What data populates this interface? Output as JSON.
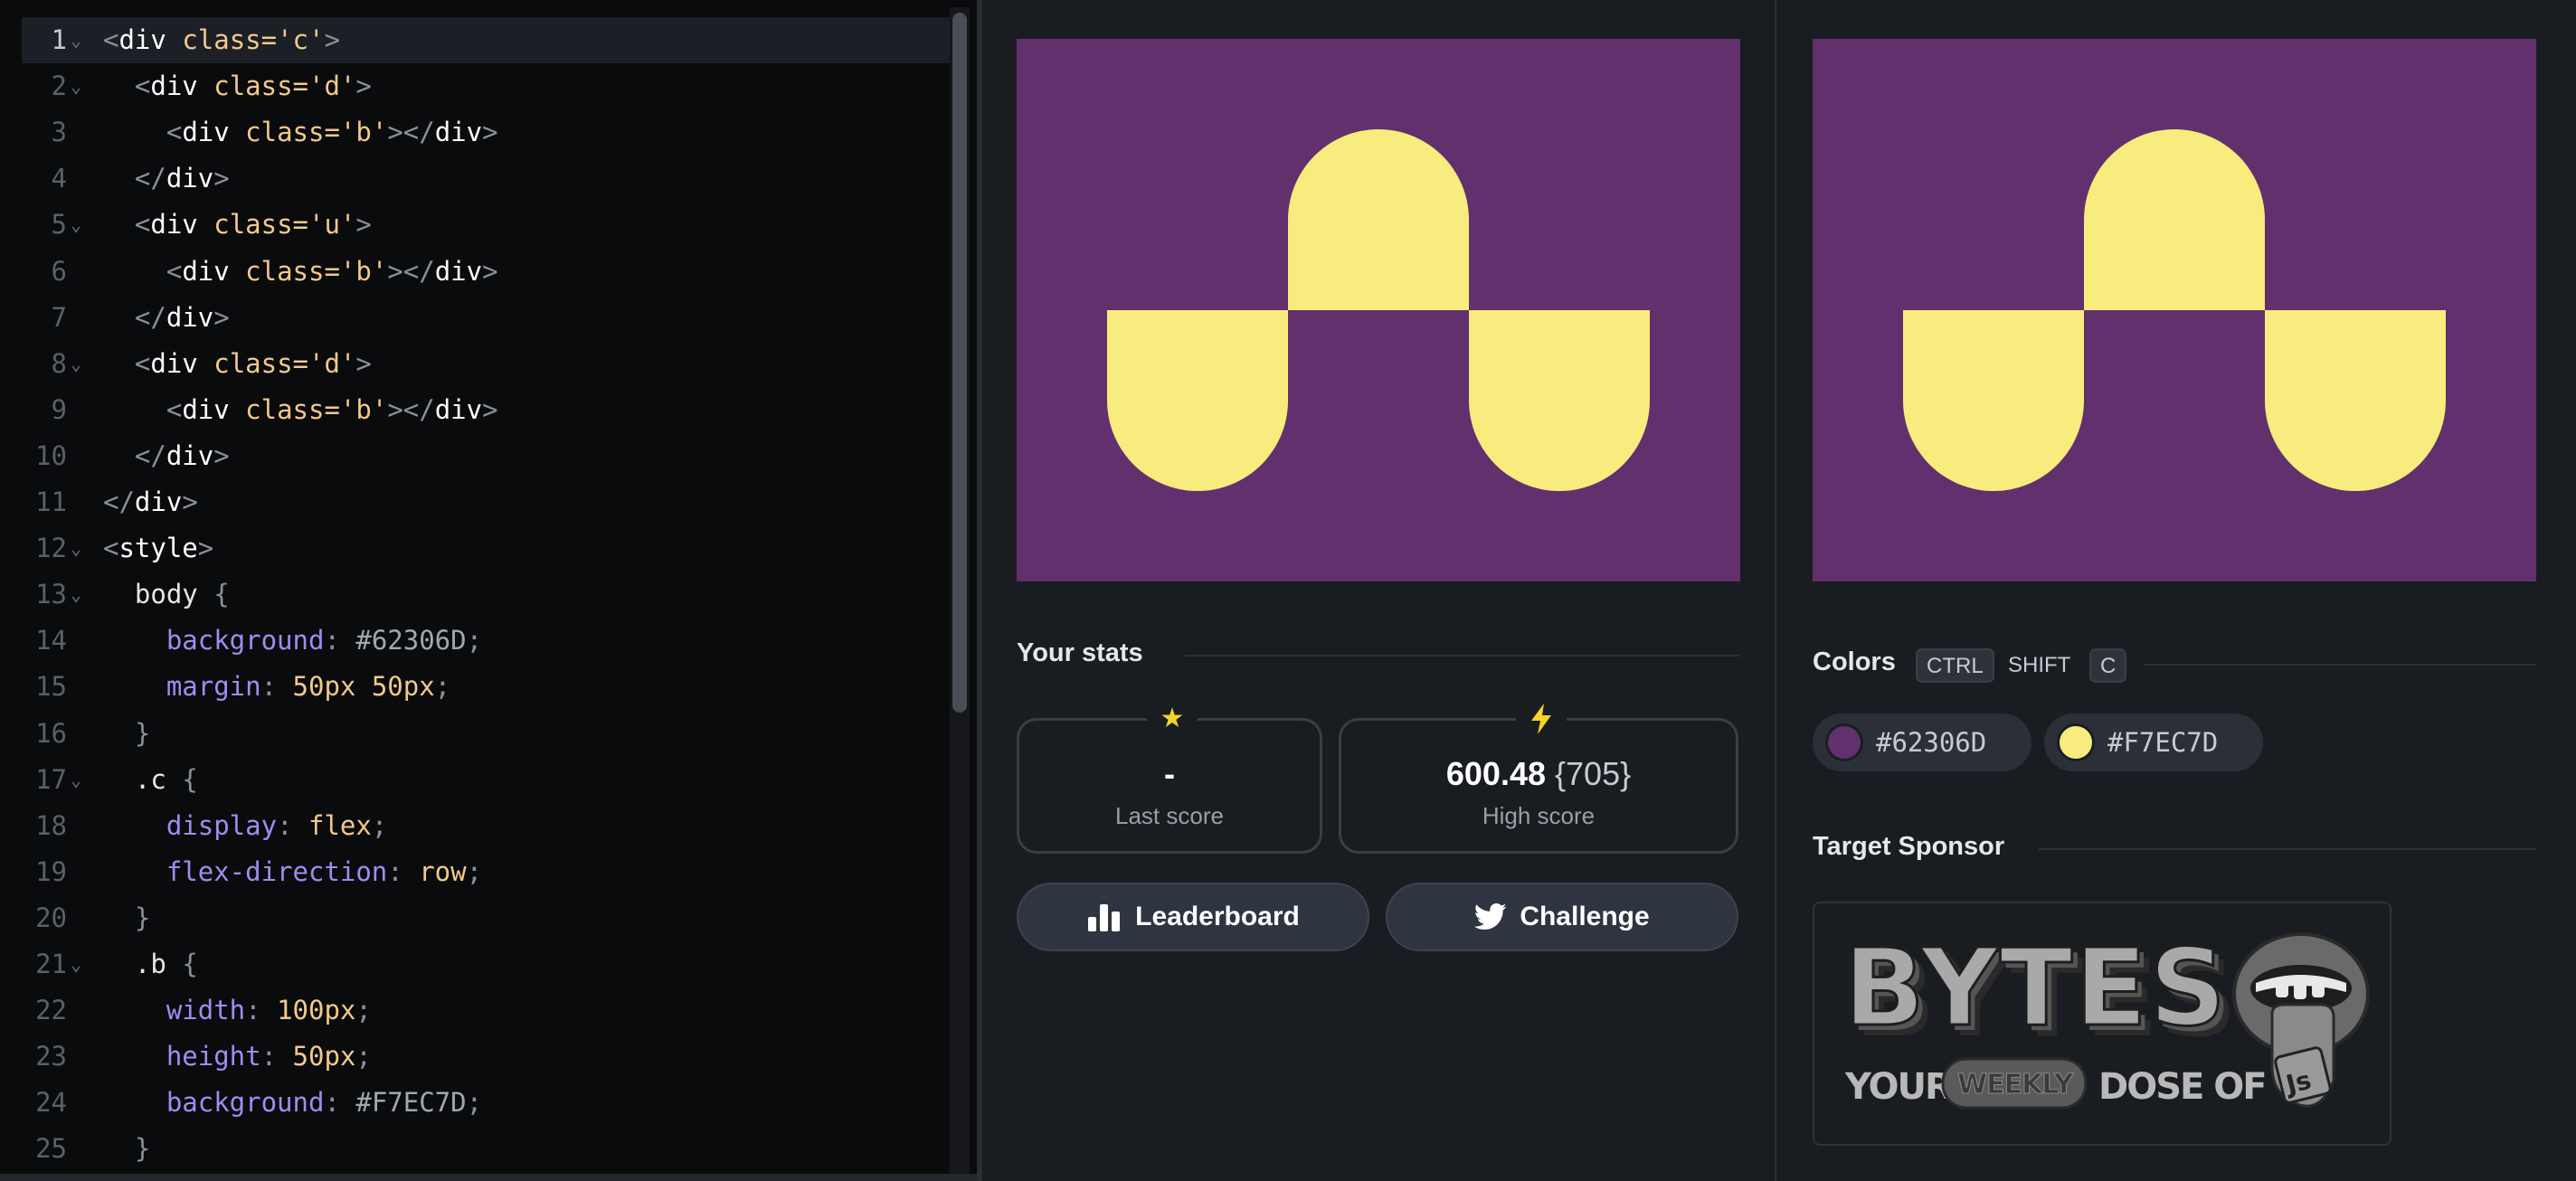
{
  "editor": {
    "lines": [
      {
        "n": "1",
        "fold": true,
        "active": true,
        "tokens": [
          [
            "<",
            "punc"
          ],
          [
            "div",
            "tag"
          ],
          [
            " class=",
            "attr"
          ],
          [
            "'c'",
            "str"
          ],
          [
            ">",
            "punc"
          ]
        ]
      },
      {
        "n": "2",
        "fold": true,
        "tokens": [
          [
            "  <",
            "punc"
          ],
          [
            "div",
            "tag"
          ],
          [
            " class=",
            "attr"
          ],
          [
            "'d'",
            "str"
          ],
          [
            ">",
            "punc"
          ]
        ]
      },
      {
        "n": "3",
        "tokens": [
          [
            "    <",
            "punc"
          ],
          [
            "div",
            "tag"
          ],
          [
            " class=",
            "attr"
          ],
          [
            "'b'",
            "str"
          ],
          [
            "></",
            "punc"
          ],
          [
            "div",
            "tag"
          ],
          [
            ">",
            "punc"
          ]
        ]
      },
      {
        "n": "4",
        "tokens": [
          [
            "  </",
            "punc"
          ],
          [
            "div",
            "tag"
          ],
          [
            ">",
            "punc"
          ]
        ]
      },
      {
        "n": "5",
        "fold": true,
        "tokens": [
          [
            "  <",
            "punc"
          ],
          [
            "div",
            "tag"
          ],
          [
            " class=",
            "attr"
          ],
          [
            "'u'",
            "str"
          ],
          [
            ">",
            "punc"
          ]
        ]
      },
      {
        "n": "6",
        "tokens": [
          [
            "    <",
            "punc"
          ],
          [
            "div",
            "tag"
          ],
          [
            " class=",
            "attr"
          ],
          [
            "'b'",
            "str"
          ],
          [
            "></",
            "punc"
          ],
          [
            "div",
            "tag"
          ],
          [
            ">",
            "punc"
          ]
        ]
      },
      {
        "n": "7",
        "tokens": [
          [
            "  </",
            "punc"
          ],
          [
            "div",
            "tag"
          ],
          [
            ">",
            "punc"
          ]
        ]
      },
      {
        "n": "8",
        "fold": true,
        "tokens": [
          [
            "  <",
            "punc"
          ],
          [
            "div",
            "tag"
          ],
          [
            " class=",
            "attr"
          ],
          [
            "'d'",
            "str"
          ],
          [
            ">",
            "punc"
          ]
        ]
      },
      {
        "n": "9",
        "tokens": [
          [
            "    <",
            "punc"
          ],
          [
            "div",
            "tag"
          ],
          [
            " class=",
            "attr"
          ],
          [
            "'b'",
            "str"
          ],
          [
            "></",
            "punc"
          ],
          [
            "div",
            "tag"
          ],
          [
            ">",
            "punc"
          ]
        ]
      },
      {
        "n": "10",
        "tokens": [
          [
            "  </",
            "punc"
          ],
          [
            "div",
            "tag"
          ],
          [
            ">",
            "punc"
          ]
        ]
      },
      {
        "n": "11",
        "tokens": [
          [
            "</",
            "punc"
          ],
          [
            "div",
            "tag"
          ],
          [
            ">",
            "punc"
          ]
        ]
      },
      {
        "n": "12",
        "fold": true,
        "tokens": [
          [
            "<",
            "punc"
          ],
          [
            "style",
            "tag"
          ],
          [
            ">",
            "punc"
          ]
        ]
      },
      {
        "n": "13",
        "fold": true,
        "tokens": [
          [
            "  body ",
            "sel"
          ],
          [
            "{",
            "punc"
          ]
        ]
      },
      {
        "n": "14",
        "tokens": [
          [
            "    background",
            "prop"
          ],
          [
            ": ",
            "punc"
          ],
          [
            "#62306D",
            "hex"
          ],
          [
            ";",
            "punc"
          ]
        ]
      },
      {
        "n": "15",
        "tokens": [
          [
            "    margin",
            "prop"
          ],
          [
            ": ",
            "punc"
          ],
          [
            "50px 50px",
            "num"
          ],
          [
            ";",
            "punc"
          ]
        ]
      },
      {
        "n": "16",
        "tokens": [
          [
            "  }",
            "punc"
          ]
        ]
      },
      {
        "n": "17",
        "fold": true,
        "tokens": [
          [
            "  .c ",
            "sel"
          ],
          [
            "{",
            "punc"
          ]
        ]
      },
      {
        "n": "18",
        "tokens": [
          [
            "    display",
            "prop"
          ],
          [
            ": ",
            "punc"
          ],
          [
            "flex",
            "val"
          ],
          [
            ";",
            "punc"
          ]
        ]
      },
      {
        "n": "19",
        "tokens": [
          [
            "    flex-direction",
            "prop"
          ],
          [
            ": ",
            "punc"
          ],
          [
            "row",
            "val"
          ],
          [
            ";",
            "punc"
          ]
        ]
      },
      {
        "n": "20",
        "tokens": [
          [
            "  }",
            "punc"
          ]
        ]
      },
      {
        "n": "21",
        "fold": true,
        "tokens": [
          [
            "  .b ",
            "sel"
          ],
          [
            "{",
            "punc"
          ]
        ]
      },
      {
        "n": "22",
        "tokens": [
          [
            "    width",
            "prop"
          ],
          [
            ": ",
            "punc"
          ],
          [
            "100px",
            "num"
          ],
          [
            ";",
            "punc"
          ]
        ]
      },
      {
        "n": "23",
        "tokens": [
          [
            "    height",
            "prop"
          ],
          [
            ": ",
            "punc"
          ],
          [
            "50px",
            "num"
          ],
          [
            ";",
            "punc"
          ]
        ]
      },
      {
        "n": "24",
        "tokens": [
          [
            "    background",
            "prop"
          ],
          [
            ": ",
            "punc"
          ],
          [
            "#F7EC7D",
            "hex"
          ],
          [
            ";",
            "punc"
          ]
        ]
      },
      {
        "n": "25",
        "tokens": [
          [
            "  }",
            "punc"
          ]
        ]
      }
    ]
  },
  "preview": {
    "background": "#62306D",
    "shape_color": "#F7EC7D"
  },
  "stats": {
    "title": "Your stats",
    "last_score": {
      "icon": "star-icon",
      "value": "-",
      "label": "Last score"
    },
    "high_score": {
      "icon": "bolt-icon",
      "value": "600.48",
      "paren": "{705}",
      "label": "High score"
    },
    "leaderboard_label": "Leaderboard",
    "challenge_label": "Challenge"
  },
  "colors": {
    "title": "Colors",
    "shortcut": [
      "CTRL",
      "SHIFT",
      "C"
    ],
    "swatches": [
      {
        "hex": "#62306D",
        "label": "#62306D"
      },
      {
        "hex": "#F7EC7D",
        "label": "#F7EC7D"
      }
    ]
  },
  "sponsor": {
    "title": "Target Sponsor",
    "logo_text": "BYTES",
    "tagline_1": "YOUR",
    "tagline_2": "WEEKLY",
    "tagline_3": "DOSE OF",
    "badge": "JS"
  }
}
